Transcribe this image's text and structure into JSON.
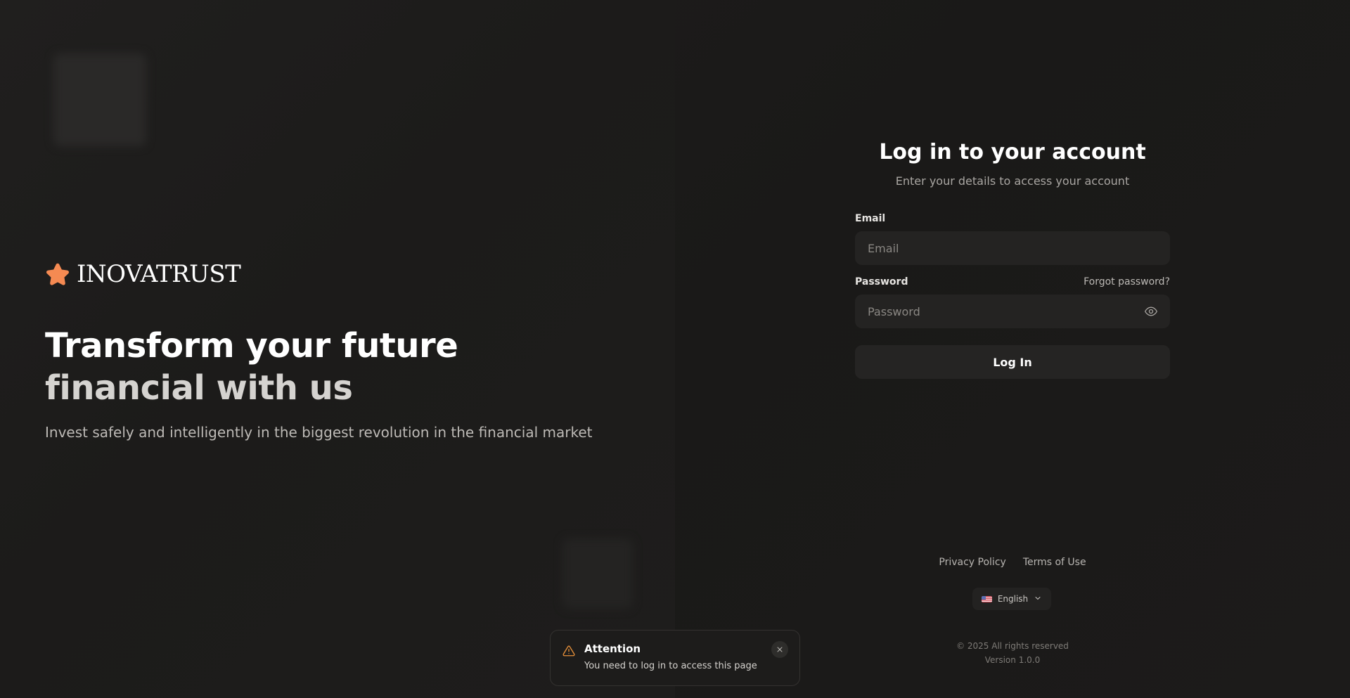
{
  "brand": {
    "name": "INOVATRUST",
    "logo_icon": "star-icon",
    "accent_color": "#f58a52"
  },
  "hero": {
    "title_line1": "Transform your future",
    "title_line2": "financial with us",
    "subtitle": "Invest safely and intelligently in the biggest revolution in the financial market"
  },
  "login": {
    "title": "Log in to your account",
    "subtitle": "Enter your details to access your account",
    "email_label": "Email",
    "email_placeholder": "Email",
    "email_value": "",
    "password_label": "Password",
    "password_placeholder": "Password",
    "password_value": "",
    "forgot_password": "Forgot password?",
    "submit_label": "Log In",
    "password_toggle_icon": "eye-icon"
  },
  "footer": {
    "privacy_policy": "Privacy Policy",
    "terms_of_use": "Terms of Use",
    "language": "English",
    "language_flag_icon": "us-flag-icon",
    "copyright": "© 2025 All rights reserved",
    "version": "Version 1.0.0"
  },
  "toast": {
    "icon": "warning-icon",
    "title": "Attention",
    "message": "You need to log in to access this page",
    "close_icon": "close-icon",
    "warning_color": "#e8913a"
  }
}
